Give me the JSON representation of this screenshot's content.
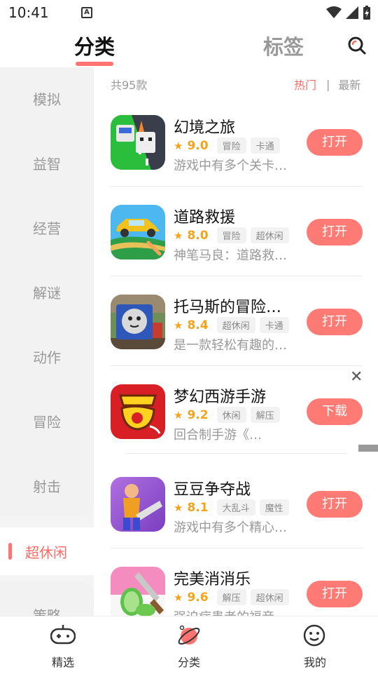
{
  "status_bar": {
    "time": "10:41",
    "notif_letter": "A"
  },
  "top_tabs": {
    "active": "分类",
    "inactive": "标签"
  },
  "sidebar": {
    "items": [
      "模拟",
      "益智",
      "经营",
      "解谜",
      "动作",
      "冒险",
      "射击"
    ],
    "active": "超休闲",
    "next": "策略"
  },
  "list_header": {
    "count": "共95款",
    "sort_hot": "热门",
    "sort_sep": "|",
    "sort_new": "最新"
  },
  "games": [
    {
      "name": "幻境之旅",
      "score": "9.0",
      "tags": [
        "冒险",
        "卡通"
      ],
      "desc": "游戏中有多个关卡…",
      "action": "打开"
    },
    {
      "name": "道路救援",
      "score": "8.0",
      "tags": [
        "冒险",
        "超休闲"
      ],
      "desc": "神笔马良：道路救…",
      "action": "打开"
    },
    {
      "name": "托马斯的冒险…",
      "score": "8.4",
      "tags": [
        "超休闲",
        "卡通"
      ],
      "desc": "是一款轻松有趣的…",
      "action": "打开"
    },
    {
      "name": "梦幻西游手游",
      "score": "9.2",
      "tags": [
        "休闲",
        "解压"
      ],
      "desc": "回合制手游《…",
      "action": "下载"
    },
    {
      "name": "豆豆争夺战",
      "score": "8.1",
      "tags": [
        "大乱斗",
        "魔性"
      ],
      "desc": "游戏中有多个精心…",
      "action": "打开"
    },
    {
      "name": "完美消消乐",
      "score": "9.6",
      "tags": [
        "解压",
        "超休闲"
      ],
      "desc": "强迫症患者的福音…",
      "action": "打开"
    }
  ],
  "bottom_nav": [
    {
      "label": "精选",
      "icon": "gamepad-icon"
    },
    {
      "label": "分类",
      "icon": "planet-icon"
    },
    {
      "label": "我的",
      "icon": "smiley-icon"
    }
  ],
  "colors": {
    "accent": "#fe7a74",
    "star": "#f7a21b"
  }
}
